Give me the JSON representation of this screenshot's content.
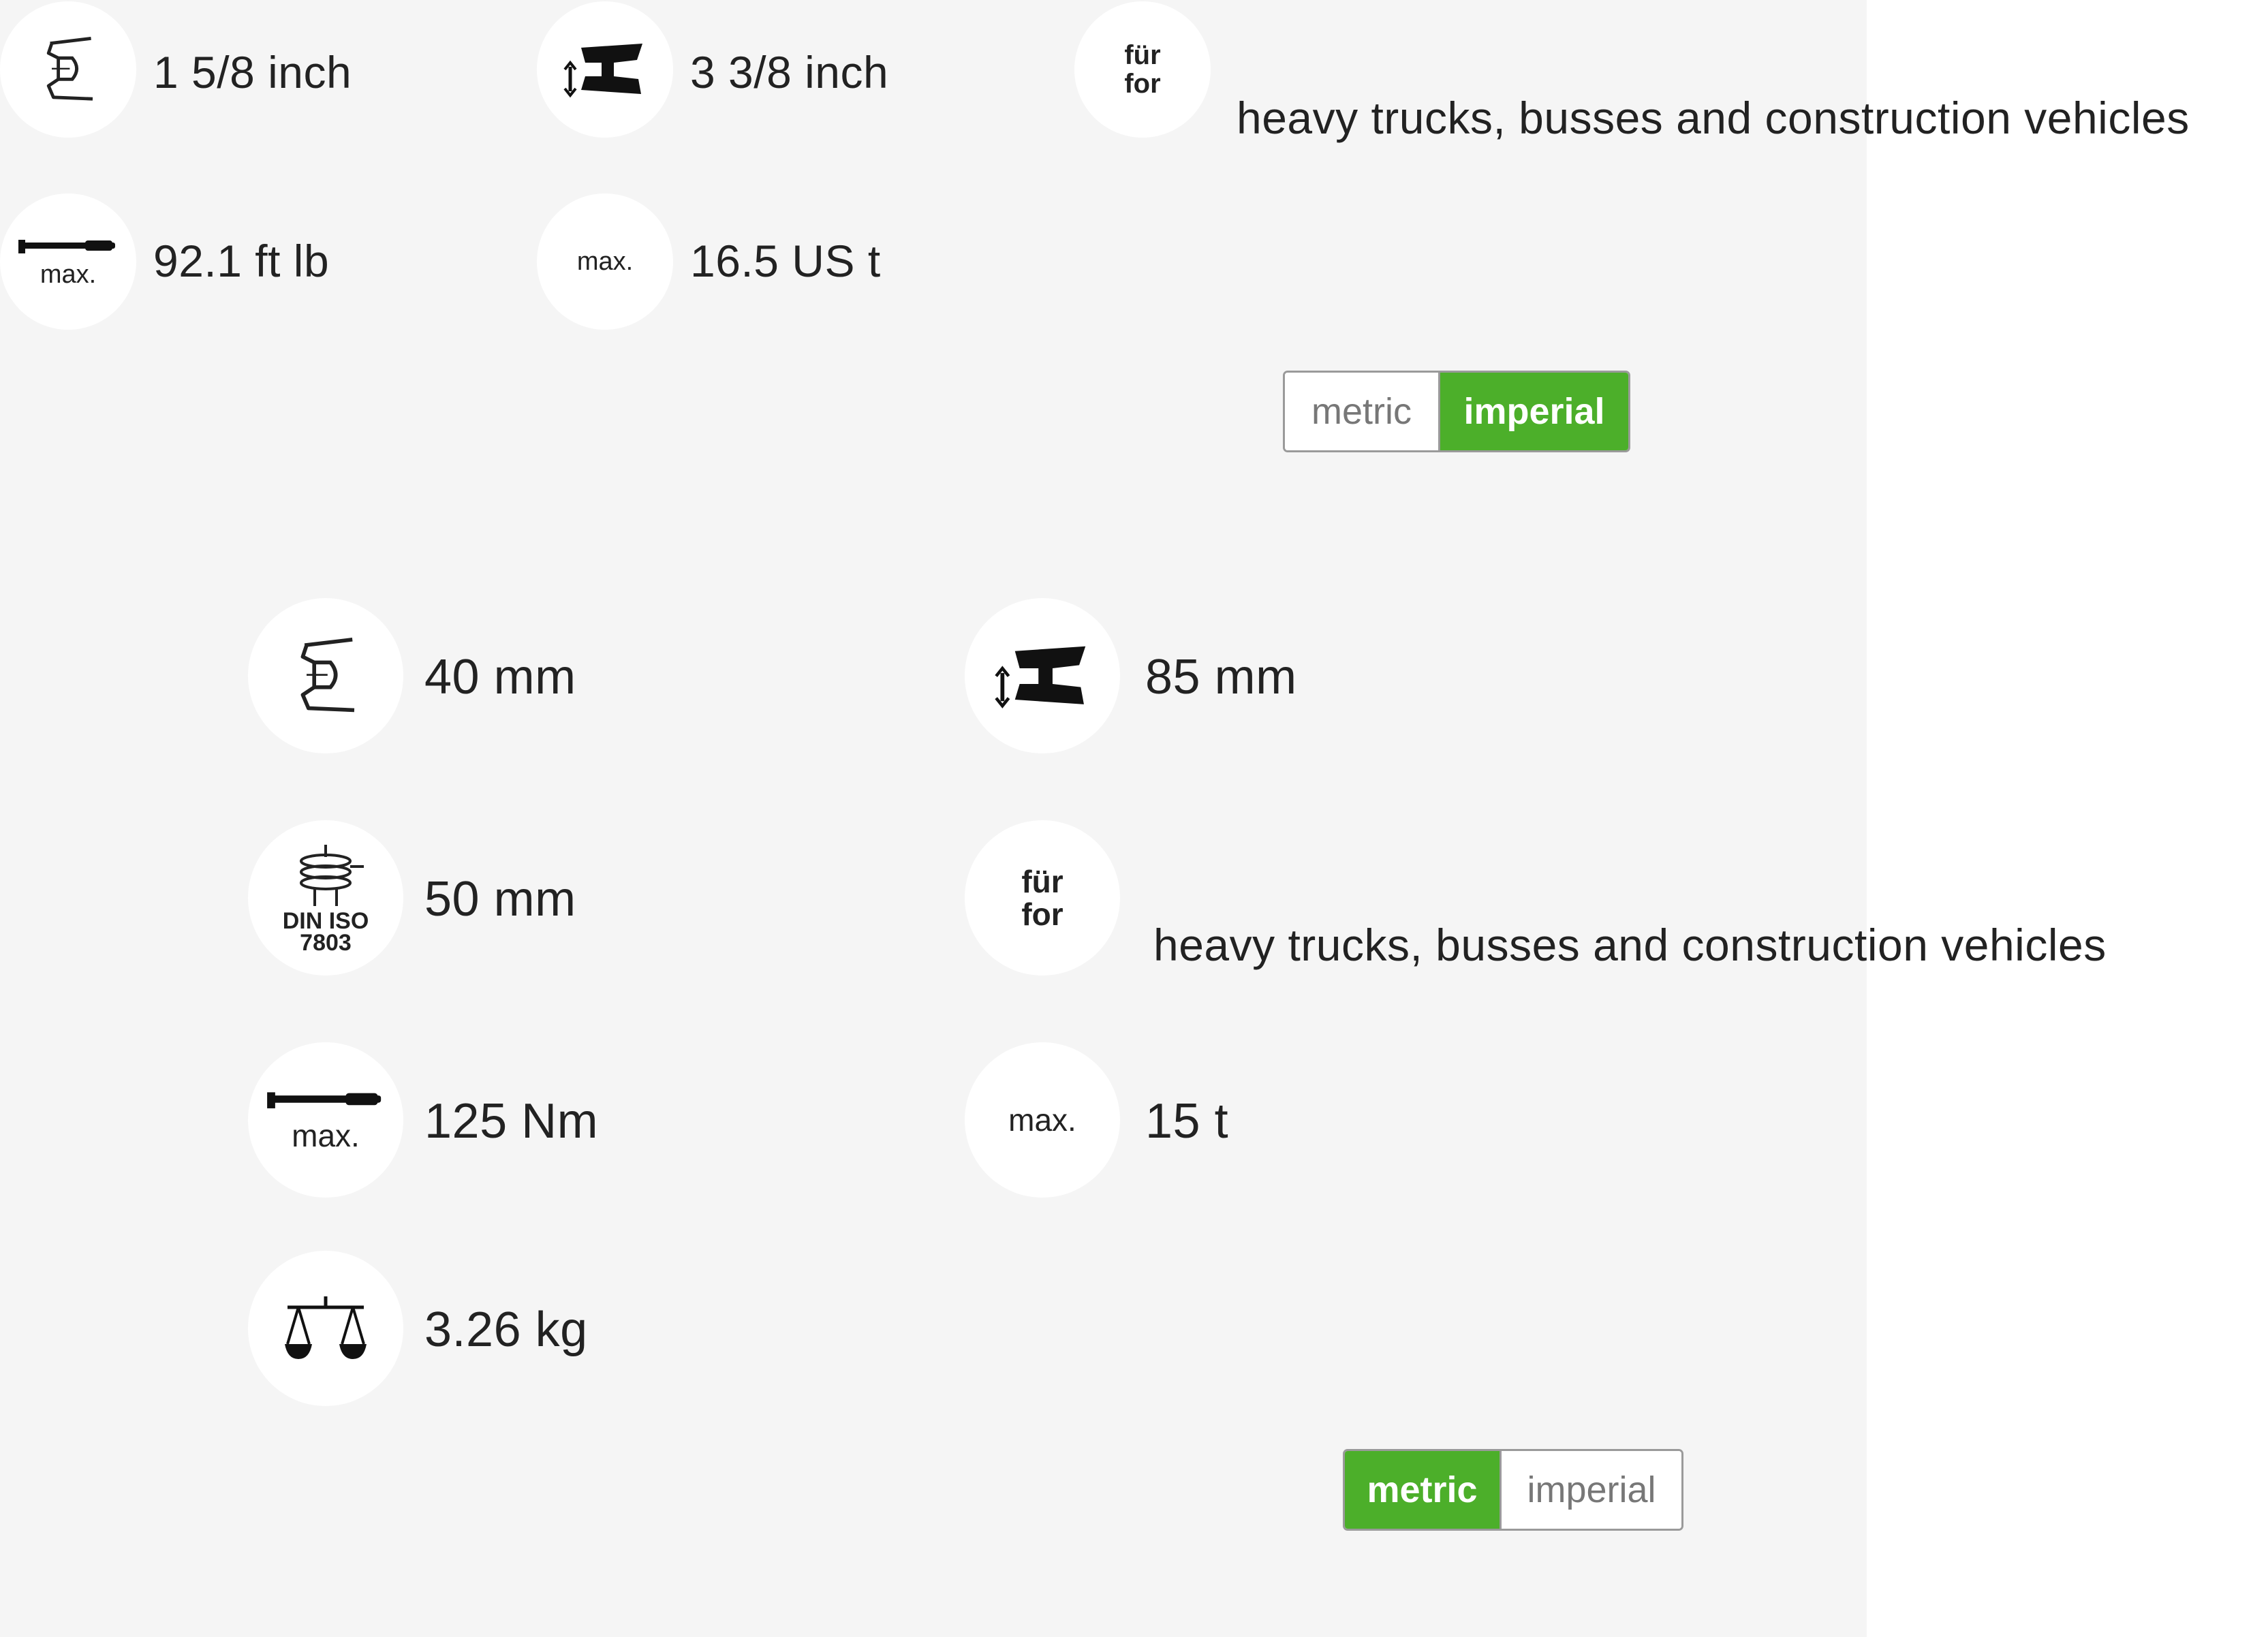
{
  "imperial_panel": {
    "specs": {
      "jaw_opening": {
        "icon": "jaw-opening-icon",
        "value": "1 5/8 inch"
      },
      "clamping_height": {
        "icon": "clamping-height-icon",
        "value": "3 3/8 inch"
      },
      "application": {
        "icon": "application-icon",
        "badge_line1": "für",
        "badge_line2": "for",
        "value": "heavy trucks, busses and construction vehicles"
      },
      "max_torque": {
        "icon": "torque-wrench-icon",
        "badge": "max.",
        "value": "92.1 ft lb"
      },
      "max_load": {
        "icon": "max-load-icon",
        "badge": "max.",
        "value": "16.5 US t"
      }
    },
    "toggle": {
      "metric_label": "metric",
      "imperial_label": "imperial",
      "selected": "imperial"
    }
  },
  "metric_panel": {
    "specs": {
      "jaw_opening": {
        "icon": "jaw-opening-icon",
        "value": "40 mm"
      },
      "clamping_height": {
        "icon": "clamping-height-icon",
        "value": "85 mm"
      },
      "din_iso": {
        "icon": "din-iso-icon",
        "badge_line1": "DIN ISO",
        "badge_line2": "7803",
        "value": "50 mm"
      },
      "application": {
        "icon": "application-icon",
        "badge_line1": "für",
        "badge_line2": "for",
        "value": "heavy trucks, busses and construction vehicles"
      },
      "max_torque": {
        "icon": "torque-wrench-icon",
        "badge": "max.",
        "value": "125 Nm"
      },
      "max_load": {
        "icon": "max-load-icon",
        "badge": "max.",
        "value": "15 t"
      },
      "weight": {
        "icon": "scale-icon",
        "value": "3.26 kg"
      }
    },
    "toggle": {
      "metric_label": "metric",
      "imperial_label": "imperial",
      "selected": "metric"
    }
  },
  "colors": {
    "accent": "#4caf2a",
    "background": "#f5f5f5",
    "text": "#222222"
  }
}
